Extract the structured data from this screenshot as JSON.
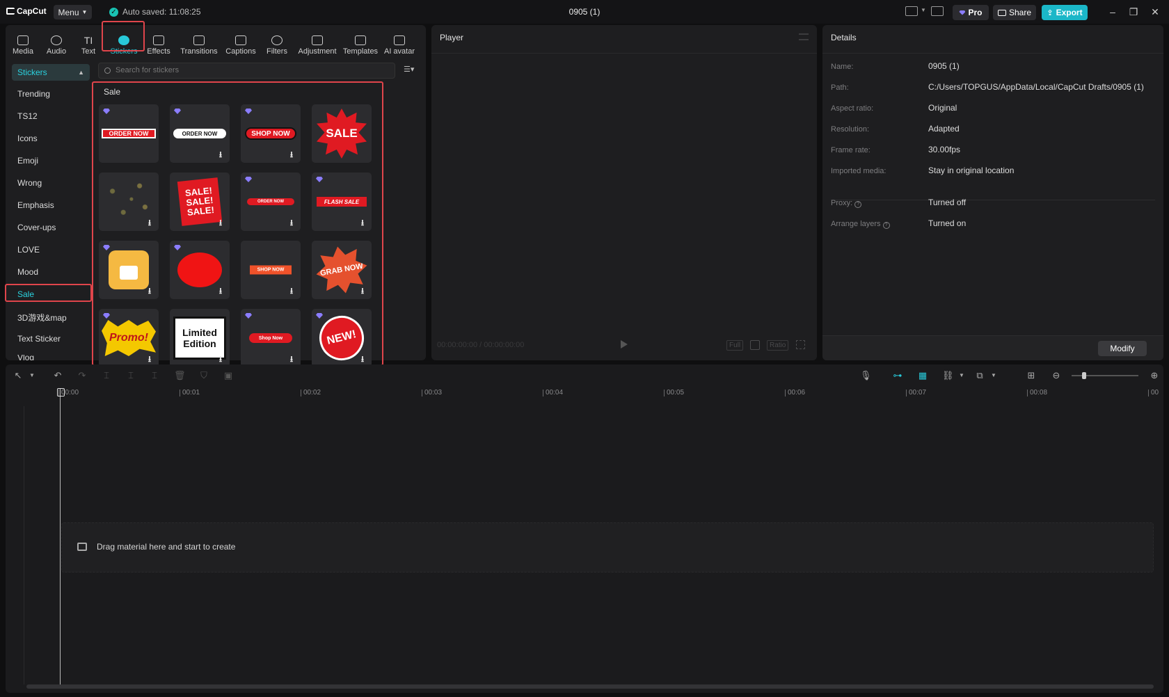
{
  "app": {
    "logo_text": "CapCut",
    "menu_label": "Menu",
    "autosave_text": "Auto saved: 11:08:25",
    "project_title": "0905 (1)",
    "pro_label": "Pro",
    "share_label": "Share",
    "export_label": "Export",
    "accent_color": "#28c9d9"
  },
  "toolbar": {
    "tabs": [
      {
        "label": "Media",
        "icon": "media-icon"
      },
      {
        "label": "Audio",
        "icon": "audio-icon"
      },
      {
        "label": "Text",
        "icon": "text-icon"
      },
      {
        "label": "Stickers",
        "icon": "stickers-icon",
        "active": true
      },
      {
        "label": "Effects",
        "icon": "effects-icon"
      },
      {
        "label": "Transitions",
        "icon": "transitions-icon"
      },
      {
        "label": "Captions",
        "icon": "captions-icon"
      },
      {
        "label": "Filters",
        "icon": "filters-icon"
      },
      {
        "label": "Adjustment",
        "icon": "adjustment-icon"
      },
      {
        "label": "Templates",
        "icon": "templates-icon"
      },
      {
        "label": "AI avatar",
        "icon": "ai-avatar-icon"
      }
    ]
  },
  "sidebar": {
    "header": "Stickers",
    "items": [
      "Trending",
      "TS12",
      "Icons",
      "Emoji",
      "Wrong",
      "Emphasis",
      "Cover-ups",
      "LOVE",
      "Mood",
      "Sale",
      "3D游戏&map",
      "Text Sticker",
      "Vlog"
    ],
    "selected": "Sale"
  },
  "search": {
    "placeholder": "Search for stickers"
  },
  "stickers": {
    "section_title": "Sale",
    "items": [
      {
        "art_text": "ORDER NOW",
        "pro": true,
        "download": false
      },
      {
        "art_text": "ORDER NOW",
        "pro": true,
        "download": true
      },
      {
        "art_text": "SHOP NOW",
        "pro": true,
        "download": true
      },
      {
        "art_text": "SALE",
        "pro": false,
        "download": false
      },
      {
        "art_text": "",
        "pro": false,
        "download": true
      },
      {
        "art_text": "SALE! SALE! SALE!",
        "pro": false,
        "download": true
      },
      {
        "art_text": "ORDER NOW",
        "pro": true,
        "download": true
      },
      {
        "art_text": "FLASH SALE",
        "pro": true,
        "download": true
      },
      {
        "art_text": "",
        "pro": true,
        "download": true
      },
      {
        "art_text": "",
        "pro": true,
        "download": true
      },
      {
        "art_text": "SHOP NOW",
        "pro": false,
        "download": true
      },
      {
        "art_text": "GRAB NOW",
        "pro": false,
        "download": true
      },
      {
        "art_text": "Promo!",
        "pro": true,
        "download": true
      },
      {
        "art_text": "Limited Edition",
        "pro": false,
        "download": true
      },
      {
        "art_text": "Shop Now",
        "pro": true,
        "download": true
      },
      {
        "art_text": "NEW!",
        "pro": true,
        "download": true
      }
    ]
  },
  "player": {
    "title": "Player",
    "timecode": "00:00:00:00 / 00:00:00:00",
    "full_label": "Full",
    "ratio_label": "Ratio"
  },
  "details": {
    "title": "Details",
    "rows": [
      {
        "label": "Name:",
        "value": "0905 (1)"
      },
      {
        "label": "Path:",
        "value": "C:/Users/TOPGUS/AppData/Local/CapCut Drafts/0905 (1)"
      },
      {
        "label": "Aspect ratio:",
        "value": "Original"
      },
      {
        "label": "Resolution:",
        "value": "Adapted"
      },
      {
        "label": "Frame rate:",
        "value": "30.00fps"
      },
      {
        "label": "Imported media:",
        "value": "Stay in original location"
      }
    ],
    "rows2": [
      {
        "label": "Proxy:",
        "value": "Turned off"
      },
      {
        "label": "Arrange layers",
        "value": "Turned on"
      }
    ],
    "modify_label": "Modify"
  },
  "timeline": {
    "ticks": [
      "00:00",
      "00:01",
      "00:02",
      "00:03",
      "00:04",
      "00:05",
      "00:06",
      "00:07",
      "00:08",
      "00"
    ],
    "drop_text": "Drag material here and start to create"
  }
}
